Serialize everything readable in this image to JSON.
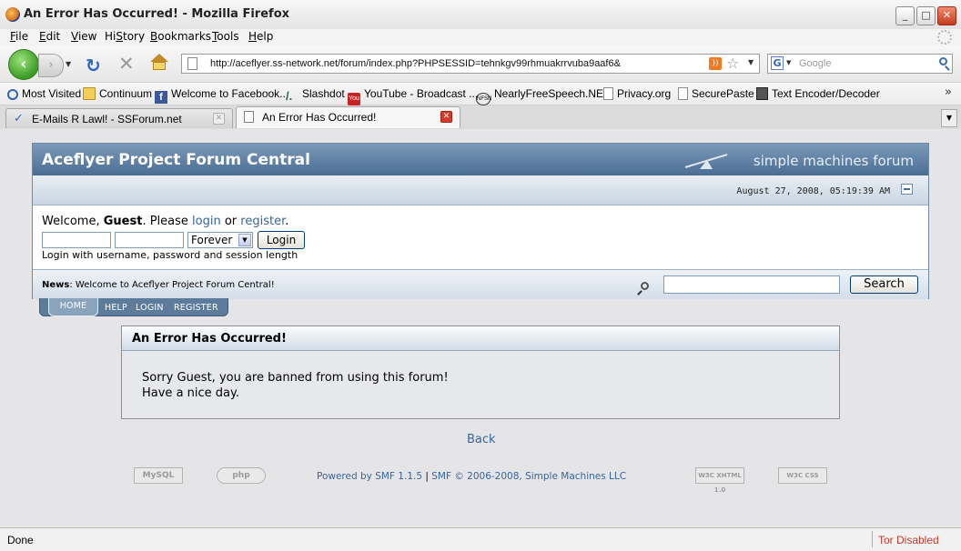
{
  "window": {
    "title": "An Error Has Occurred! - Mozilla Firefox"
  },
  "menu": {
    "items": [
      "File",
      "Edit",
      "View",
      "History",
      "Bookmarks",
      "Tools",
      "Help"
    ],
    "mnemonics": [
      "F",
      "E",
      "V",
      "S",
      "B",
      "T",
      "H"
    ]
  },
  "nav": {
    "url": "http://aceflyer.ss-network.net/forum/index.php?PHPSESSID=tehnkgv99rhmuakrrvuba9aaf6&",
    "search_placeholder": "Google"
  },
  "bookmarks": [
    {
      "label": "Most Visited",
      "icon": "search-icon"
    },
    {
      "label": "Continuum",
      "icon": "folder-icon"
    },
    {
      "label": "Welcome to Facebook...",
      "icon": "facebook-icon"
    },
    {
      "label": "Slashdot",
      "icon": "slashdot-icon"
    },
    {
      "label": "YouTube - Broadcast ...",
      "icon": "youtube-icon"
    },
    {
      "label": "NearlyFreeSpeech.NET",
      "icon": "nfsn-icon"
    },
    {
      "label": "Privacy.org",
      "icon": "page-icon"
    },
    {
      "label": "SecurePaste",
      "icon": "page-icon"
    },
    {
      "label": "Text Encoder/Decoder",
      "icon": "encoder-icon"
    }
  ],
  "tabs": [
    {
      "label": "E-Mails R Lawl! - SSForum.net",
      "active": false
    },
    {
      "label": "An Error Has Occurred!",
      "active": true
    }
  ],
  "forum": {
    "title": "Aceflyer Project Forum Central",
    "logo_text": "simple machines forum",
    "date": "August 27, 2008, 05:19:39 AM",
    "welcome_prefix": "Welcome, ",
    "guest": "Guest",
    "please": ". Please ",
    "login_link": "login",
    "or": " or ",
    "register_link": "register",
    "period": ".",
    "session_option": "Forever",
    "login_button": "Login",
    "login_hint": "Login with username, password and session length",
    "news_label": "News",
    "news_text": ": Welcome to Aceflyer Project Forum Central!",
    "search_button": "Search",
    "nav_tabs": [
      "HOME",
      "HELP",
      "LOGIN",
      "REGISTER"
    ],
    "error_title": "An Error Has Occurred!",
    "error_line1": "Sorry Guest, you are banned from using this forum!",
    "error_line2": "Have a nice day.",
    "back_link": "Back",
    "powered_by": "Powered by SMF 1.1.5",
    "separator": " | ",
    "copyright": "SMF © 2006-2008, Simple Machines LLC",
    "badges": [
      "MySQL",
      "php",
      "W3C XHTML 1.0",
      "W3C CSS"
    ]
  },
  "status": {
    "left": "Done",
    "tor": "Tor Disabled"
  },
  "colors": {
    "header_blue": "#4a6d94",
    "link_blue": "#36659c",
    "tor_red": "#c43a2a"
  }
}
